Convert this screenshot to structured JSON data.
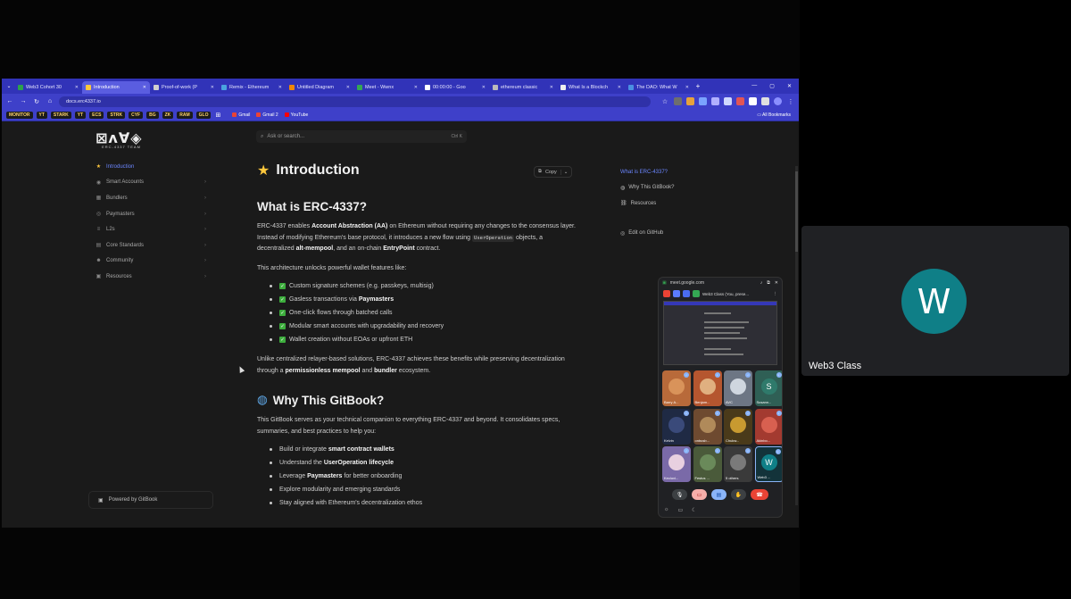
{
  "browser": {
    "tabs": [
      {
        "label": "Web3 Cohort 30",
        "color": "#2ca24c",
        "active": false
      },
      {
        "label": "Introduction",
        "color": "#ffc83d",
        "active": true
      },
      {
        "label": "Proof-of-work (P",
        "color": "#cfcfcf",
        "active": false
      },
      {
        "label": "Remix - Ethereum",
        "color": "#4aa3df",
        "active": false
      },
      {
        "label": "Untitled Diagram",
        "color": "#f08705",
        "active": false
      },
      {
        "label": "Meet - Wwnx",
        "color": "#34a853",
        "active": false
      },
      {
        "label": "00:00:00 - Goo",
        "color": "#ffffff",
        "active": false
      },
      {
        "label": "ethereum classic",
        "color": "#bbbbbb",
        "active": false
      },
      {
        "label": "What Is a Blockch",
        "color": "#eeeeee",
        "active": false
      },
      {
        "label": "The DAO: What W",
        "color": "#4a90e2",
        "active": false
      }
    ],
    "url": "docs.erc4337.io",
    "bookmarks": [
      "MONITOR",
      "YT",
      "STARK",
      "YT",
      "ECS",
      "STRK",
      "CYF",
      "BG",
      "ZK",
      "RAM",
      "GLO"
    ],
    "bookmark_links": [
      {
        "label": "Gmail",
        "color": "#ea4335"
      },
      {
        "label": "Gmail 2",
        "color": "#ea4335"
      },
      {
        "label": "YouTube",
        "color": "#ff0000"
      }
    ],
    "all_bookmarks": "All Bookmarks"
  },
  "site": {
    "logo_sub": "ERC-4337 TEAM",
    "search_placeholder": "Ask or search...",
    "search_kbd": "Ctrl K",
    "sidebar": [
      {
        "label": "Introduction",
        "icon": "star-icon",
        "active": true,
        "chevron": false
      },
      {
        "label": "Smart Accounts",
        "icon": "wallet-icon",
        "active": false,
        "chevron": true
      },
      {
        "label": "Bundlers",
        "icon": "box-icon",
        "active": false,
        "chevron": true
      },
      {
        "label": "Paymasters",
        "icon": "coin-icon",
        "active": false,
        "chevron": true
      },
      {
        "label": "L2s",
        "icon": "layers-icon",
        "active": false,
        "chevron": true
      },
      {
        "label": "Core Standards",
        "icon": "book-icon",
        "active": false,
        "chevron": true
      },
      {
        "label": "Community",
        "icon": "people-icon",
        "active": false,
        "chevron": true
      },
      {
        "label": "Resources",
        "icon": "folder-icon",
        "active": false,
        "chevron": true
      }
    ],
    "powered_by": "Powered by GitBook",
    "copy_label": "Copy"
  },
  "article": {
    "title": "Introduction",
    "h2_1": "What is ERC-4337?",
    "p1_a": "ERC-4337 enables ",
    "p1_b": "Account Abstraction (AA)",
    "p1_c": " on Ethereum without requiring any changes to the consensus layer. Instead of modifying Ethereum's base protocol, it introduces a new flow using ",
    "p1_code": "UserOperation",
    "p1_d": " objects, a decentralized ",
    "p1_e": "alt-mempool",
    "p1_f": ", and an on-chain ",
    "p1_g": "EntryPoint",
    "p1_h": " contract.",
    "p2": "This architecture unlocks powerful wallet features like:",
    "features": [
      {
        "text": "Custom signature schemes (e.g. passkeys, multisig)",
        "bold": ""
      },
      {
        "text": "Gasless transactions via ",
        "bold": "Paymasters"
      },
      {
        "text": "One-click flows through batched calls",
        "bold": ""
      },
      {
        "text": "Modular smart accounts with upgradability and recovery",
        "bold": ""
      },
      {
        "text": "Wallet creation without EOAs or upfront ETH",
        "bold": ""
      }
    ],
    "p3_a": "Unlike centralized relayer-based solutions, ERC-4337 achieves these benefits while preserving decentralization through a ",
    "p3_b": "permissionless mempool",
    "p3_c": " and ",
    "p3_d": "bundler",
    "p3_e": " ecosystem.",
    "h2_2": "Why This GitBook?",
    "p4": "This GitBook serves as your technical companion to everything ERC-4337 and beyond. It consolidates specs, summaries, and best practices to help you:",
    "bullets": [
      {
        "pre": "Build or integrate ",
        "bold": "smart contract wallets",
        "post": ""
      },
      {
        "pre": "Understand the ",
        "bold": "UserOperation lifecycle",
        "post": ""
      },
      {
        "pre": "Leverage ",
        "bold": "Paymasters",
        "post": " for better onboarding"
      },
      {
        "pre": "Explore modularity and emerging standards",
        "bold": "",
        "post": ""
      },
      {
        "pre": "Stay aligned with Ethereum's decentralization ethos",
        "bold": "",
        "post": ""
      }
    ]
  },
  "toc": {
    "items": [
      {
        "label": "What is ERC-4337?",
        "active": true,
        "icon": ""
      },
      {
        "label": "Why This GitBook?",
        "active": false,
        "icon": "globe-icon"
      },
      {
        "label": "Resources",
        "active": false,
        "icon": "link-icon"
      }
    ],
    "github": "Edit on GitHub"
  },
  "meet_pip": {
    "url": "meet.google.com",
    "presenting": "Web3 Class (You, prese...",
    "tiles": [
      {
        "name": "Barry A...",
        "color": "#b86a3a",
        "avatar": "",
        "avcolor": "#d9935a"
      },
      {
        "name": "Benjam...",
        "color": "#b5562f",
        "avatar": "",
        "avcolor": "#e0b080"
      },
      {
        "name": "AVC",
        "color": "#6d7684",
        "avatar": "",
        "avcolor": "#cfd6df"
      },
      {
        "name": "Susann...",
        "color": "#2f5f55",
        "avatar": "S",
        "avcolor": "#2f7a6b"
      },
      {
        "name": "Kelvin",
        "color": "#1f2a44",
        "avatar": "",
        "avcolor": "#3a4a7a"
      },
      {
        "name": "onbusb...",
        "color": "#6e4a30",
        "avatar": "",
        "avcolor": "#b08a5a"
      },
      {
        "name": "Chukw...",
        "color": "#4a3a1a",
        "avatar": "",
        "avcolor": "#c89a30"
      },
      {
        "name": "Akinbo...",
        "color": "#a33a30",
        "avatar": "",
        "avcolor": "#d86050"
      },
      {
        "name": "Kecluvi...",
        "color": "#7a6aa8",
        "avatar": "",
        "avcolor": "#e8d0e0"
      },
      {
        "name": "Festus ...",
        "color": "#4a5a3a",
        "avatar": "",
        "avcolor": "#6a8a5a"
      },
      {
        "name": "5 others",
        "color": "#3a3a3a",
        "avatar": "",
        "avcolor": "#7a7a7a"
      },
      {
        "name": "Web3 ...",
        "color": "#13333a",
        "avatar": "W",
        "avcolor": "#0f7f87"
      }
    ]
  },
  "participant": {
    "initial": "W",
    "name": "Web3 Class"
  }
}
